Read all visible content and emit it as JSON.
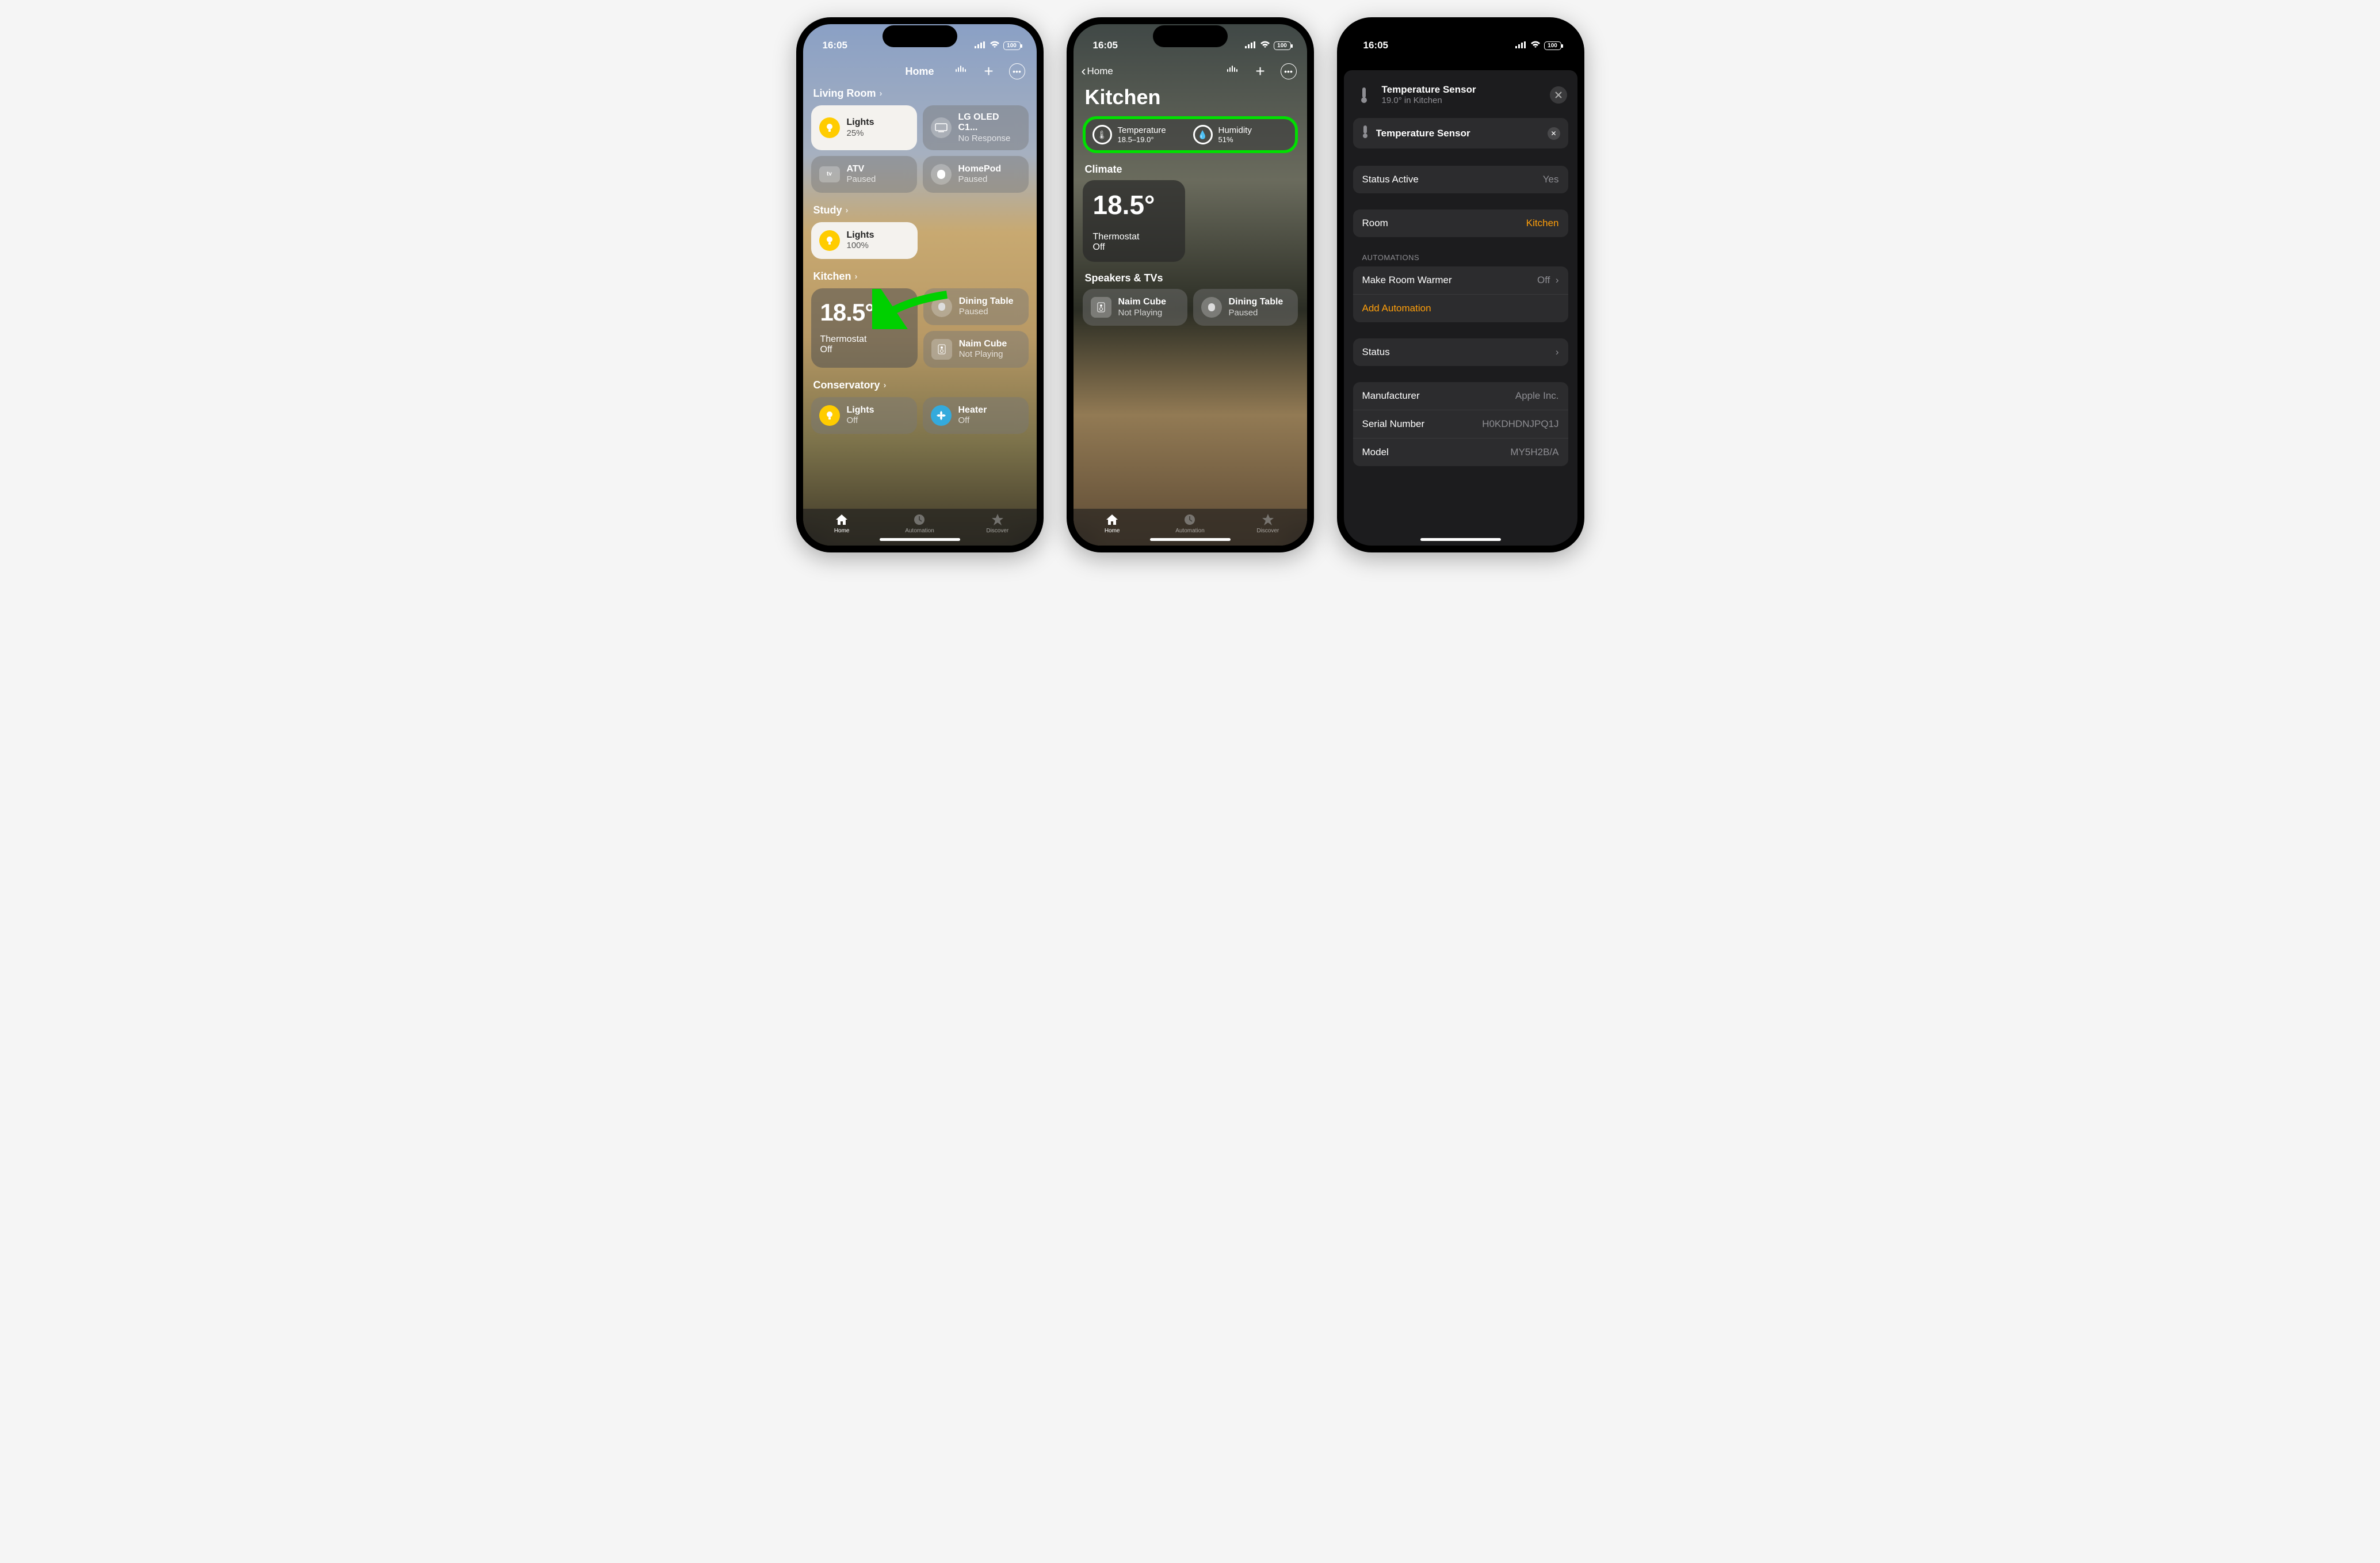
{
  "status": {
    "time": "16:05",
    "battery": "100"
  },
  "phone1": {
    "title": "Home",
    "rooms": {
      "livingRoom": {
        "name": "Living Room",
        "tiles": [
          {
            "title": "Lights",
            "sub": "25%",
            "icon": "bulb",
            "style": "white"
          },
          {
            "title": "LG OLED C1...",
            "sub": "No Response",
            "icon": "tv"
          },
          {
            "title": "ATV",
            "sub": "Paused",
            "icon": "atv"
          },
          {
            "title": "HomePod",
            "sub": "Paused",
            "icon": "homepod"
          }
        ]
      },
      "study": {
        "name": "Study",
        "tiles": [
          {
            "title": "Lights",
            "sub": "100%",
            "icon": "bulb",
            "style": "white"
          }
        ]
      },
      "kitchen": {
        "name": "Kitchen",
        "climate": {
          "temp": "18.5°",
          "label": "Thermostat",
          "state": "Off"
        },
        "tiles": [
          {
            "title": "Dining Table",
            "sub": "Paused",
            "icon": "homepod"
          },
          {
            "title": "Naim Cube",
            "sub": "Not Playing",
            "icon": "speaker"
          }
        ]
      },
      "conservatory": {
        "name": "Conservatory",
        "tiles": [
          {
            "title": "Lights",
            "sub": "Off",
            "icon": "bulb-dark"
          },
          {
            "title": "Heater",
            "sub": "Off",
            "icon": "fan"
          }
        ]
      }
    },
    "tabs": {
      "home": "Home",
      "automation": "Automation",
      "discover": "Discover"
    }
  },
  "phone2": {
    "back": "Home",
    "title": "Kitchen",
    "sensors": {
      "temp": {
        "label": "Temperature",
        "value": "18.5–19.0°"
      },
      "humidity": {
        "label": "Humidity",
        "value": "51%"
      }
    },
    "climateLabel": "Climate",
    "climate": {
      "temp": "18.5°",
      "label": "Thermostat",
      "state": "Off"
    },
    "speakersLabel": "Speakers & TVs",
    "speakers": [
      {
        "title": "Naim Cube",
        "sub": "Not Playing",
        "icon": "speaker"
      },
      {
        "title": "Dining Table",
        "sub": "Paused",
        "icon": "homepod"
      }
    ]
  },
  "phone3": {
    "header": {
      "title": "Temperature Sensor",
      "sub": "19.0° in Kitchen"
    },
    "nameField": "Temperature Sensor",
    "statusActive": {
      "label": "Status Active",
      "value": "Yes"
    },
    "room": {
      "label": "Room",
      "value": "Kitchen"
    },
    "automationsLabel": "AUTOMATIONS",
    "automations": [
      {
        "label": "Make Room Warmer",
        "value": "Off"
      }
    ],
    "addAutomation": "Add Automation",
    "statusRow": "Status",
    "info": {
      "manufacturer": {
        "label": "Manufacturer",
        "value": "Apple Inc."
      },
      "serial": {
        "label": "Serial Number",
        "value": "H0KDHDNJPQ1J"
      },
      "model": {
        "label": "Model",
        "value": "MY5H2B/A"
      }
    }
  }
}
